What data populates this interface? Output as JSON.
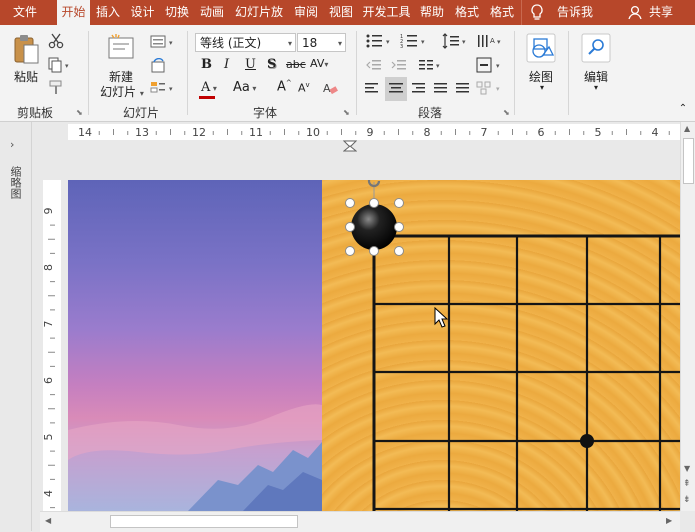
{
  "tabs": {
    "file": "文件",
    "home": "开始",
    "insert": "插入",
    "design": "设计",
    "transitions": "切换",
    "animations": "动画",
    "slideshow": "幻灯片放",
    "review": "审阅",
    "view": "视图",
    "developer": "开发工具",
    "help": "帮助",
    "format1": "格式",
    "format2": "格式",
    "tellme": "告诉我",
    "share": "共享"
  },
  "clipboard": {
    "paste": "粘贴",
    "group": "剪贴板"
  },
  "slides": {
    "new_line1": "新建",
    "new_line2": "幻灯片",
    "group": "幻灯片"
  },
  "font": {
    "family": "等线 (正文)",
    "size": "18",
    "bold": "B",
    "italic": "I",
    "underline": "U",
    "shadow": "S",
    "strike": "abc",
    "spacing": "AV",
    "font_color": "A",
    "change_case": "Aa",
    "grow": "A",
    "shrink": "A",
    "group": "字体"
  },
  "paragraph": {
    "group": "段落"
  },
  "drawing": {
    "label": "绘图"
  },
  "editing": {
    "label": "编辑"
  },
  "thumbnail_pane": {
    "label": "缩略图"
  },
  "hruler_ticks": [
    "14",
    "13",
    "12",
    "11",
    "10",
    "9",
    "8",
    "7",
    "6",
    "5",
    "4"
  ],
  "vruler_ticks": [
    "9",
    "8",
    "7",
    "6",
    "5",
    "4"
  ],
  "colors": {
    "accent": "#b7472a",
    "ribbon": "#f3f3f3",
    "board": "#efb048",
    "stone": "#000000"
  }
}
